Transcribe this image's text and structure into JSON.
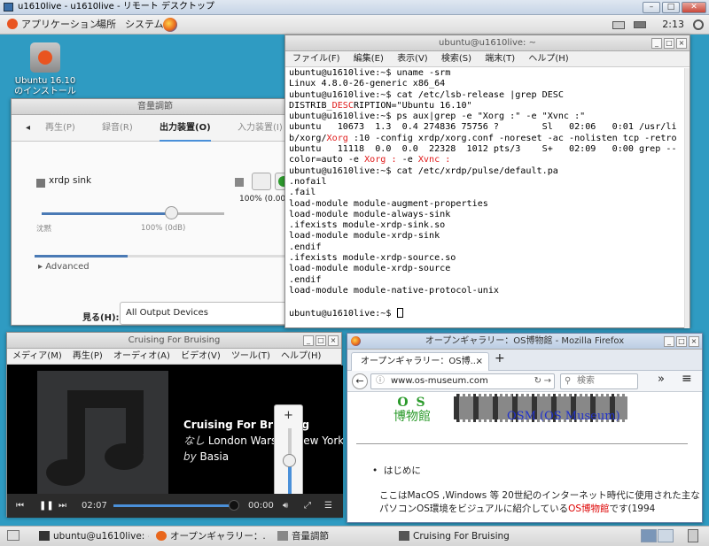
{
  "rdp": {
    "title": "u1610live - u1610live - リモート デスクトップ"
  },
  "top_panel": {
    "applications": "アプリケーション",
    "places": "場所",
    "system": "システム",
    "clock": "2:13"
  },
  "desktop_icon": {
    "label": "Ubuntu 16.10 のインストール"
  },
  "volume_control": {
    "title": "音量調節",
    "tabs": [
      "再生(P)",
      "録音(R)",
      "出力装置(O)",
      "入力装置(I)"
    ],
    "device": "xrdp sink",
    "label_silent": "沈黙",
    "label_100": "100% (0dB)",
    "percent_label": "100% (0.00dB",
    "advanced": "Advanced",
    "show_label": "見る(H):",
    "show_value": "All Output Devices",
    "volume_percent": 71,
    "level_percent": 35
  },
  "terminal": {
    "title": "ubuntu@u1610live: ~",
    "menu": [
      "ファイル(F)",
      "編集(E)",
      "表示(V)",
      "検索(S)",
      "端末(T)",
      "ヘルプ(H)"
    ],
    "lines": [
      "ubuntu@u1610live:~$ uname -srm",
      "Linux 4.8.0-26-generic x86_64",
      "ubuntu@u1610live:~$ cat /etc/lsb-release |grep DESC",
      [
        "DISTRIB_",
        "DESC",
        "RIPTION=\"Ubuntu 16.10\""
      ],
      "ubuntu@u1610live:~$ ps aux|grep -e \"Xorg :\" -e \"Xvnc :\"",
      "ubuntu   10673  1.3  0.4 274836 75756 ?        Sl   02:06   0:01 /usr/li",
      [
        "b/xorg/",
        "Xorg",
        " :10 -config xrdp/xorg.conf -noreset -ac -nolisten tcp -retro"
      ],
      "ubuntu   11118  0.0  0.0  22328  1012 pts/3    S+   02:09   0:00 grep --",
      [
        "color=auto -e ",
        "Xorg :",
        " -e ",
        "Xvnc :"
      ],
      "ubuntu@u1610live:~$ cat /etc/xrdp/pulse/default.pa",
      ".nofail",
      ".fail",
      "load-module module-augment-properties",
      "load-module module-always-sink",
      ".ifexists module-xrdp-sink.so",
      "load-module module-xrdp-sink",
      ".endif",
      ".ifexists module-xrdp-source.so",
      "load-module module-xrdp-source",
      ".endif",
      "load-module module-native-protocol-unix",
      "",
      "ubuntu@u1610live:~$ "
    ]
  },
  "video_player": {
    "title": "Cruising For Bruising",
    "menu": [
      "メディア(M)",
      "再生(P)",
      "オーディオ(A)",
      "ビデオ(V)",
      "ツール(T)",
      "ヘルプ(H)"
    ],
    "track_title": "Cruising For Bruising",
    "line2_it": "なし",
    "line2": " London Warsaw New York",
    "line3_it": "by",
    "line3": " Basia",
    "time_elapsed": "02:07",
    "time_total": "00:00",
    "seek_percent": 100,
    "volume_percent": 55
  },
  "firefox": {
    "title": "オープンギャラリー：OS博物館 - Mozilla Firefox",
    "tab_title": "オープンギャラリー：OS博...",
    "url": "www.os-museum.com",
    "search_placeholder": "検索",
    "logo_line1": "O S",
    "logo_line2": "博物館",
    "site_title": "OSM (OS Museum)",
    "bullet": "はじめに",
    "para_line1": "ここはMacOS ,Windows 等 20世紀のインターネット時代に使用された主な",
    "para_line2_a": "パソコンOS環境をビジュアルに紹介している",
    "para_line2_red": "OS博物館",
    "para_line2_b": "です(1994"
  },
  "taskbar": {
    "items": [
      "ubuntu@u1610live: ~",
      "オープンギャラリー：...",
      "音量調節",
      "Cruising For Bruising"
    ]
  },
  "colors": {
    "desktop": "#2f9bc2",
    "accent": "#4a90d9",
    "terminal_highlight": "#e01b1b"
  }
}
